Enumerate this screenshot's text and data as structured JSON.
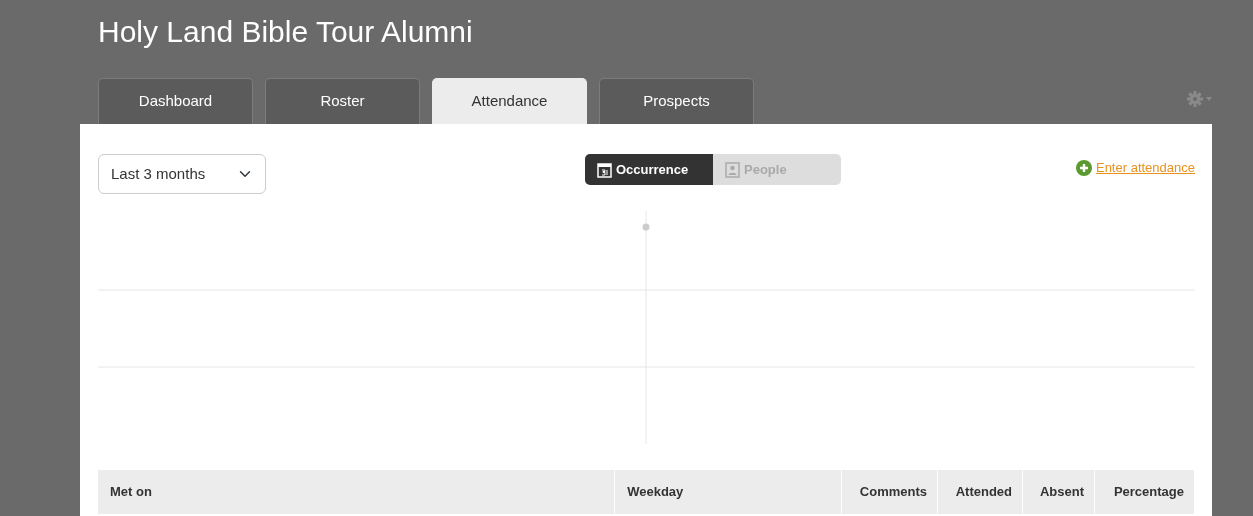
{
  "title": "Holy Land Bible Tour Alumni",
  "tabs": [
    {
      "label": "Dashboard",
      "selected": false
    },
    {
      "label": "Roster",
      "selected": false
    },
    {
      "label": "Attendance",
      "selected": true
    },
    {
      "label": "Prospects",
      "selected": false
    }
  ],
  "period": {
    "value": "Last 3 months"
  },
  "view_toggle": [
    {
      "label": "Occurrence",
      "kind": "calendar",
      "selected": true
    },
    {
      "label": "People",
      "kind": "person",
      "selected": false
    }
  ],
  "enter_link": "Enter attendance",
  "table": {
    "columns": [
      "Met on",
      "Weekday",
      "Comments",
      "Attended",
      "Absent",
      "Percentage"
    ]
  }
}
